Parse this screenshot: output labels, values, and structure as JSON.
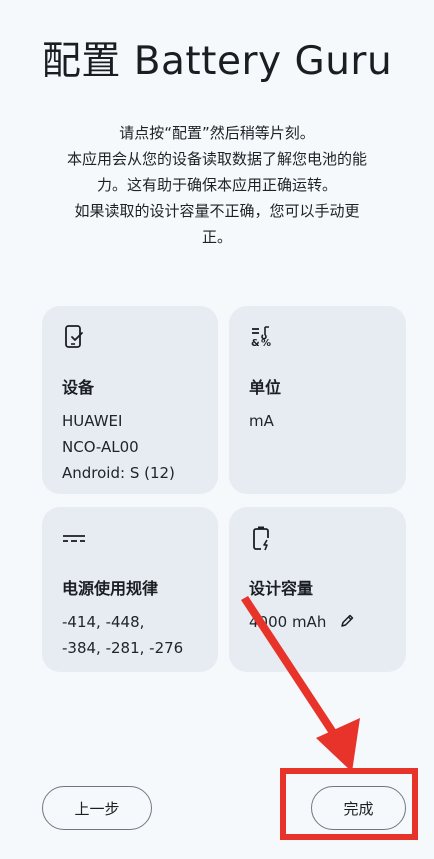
{
  "header": {
    "title": "配置 Battery Guru"
  },
  "intro": {
    "line1": "请点按“配置”然后稍等片刻。",
    "line2": "本应用会从您的设备读取数据了解您电池的能",
    "line3": "力。这有助于确保本应用正确运转。",
    "line4": "如果读取的设计容量不正确，您可以手动更",
    "line5": "正。"
  },
  "cards": {
    "device": {
      "icon": "phone-check-icon",
      "label": "设备",
      "line1": "HUAWEI",
      "line2": "NCO-AL00",
      "line3": "Android: S (12)"
    },
    "unit": {
      "icon": "units-icon",
      "label": "单位",
      "value": "mA"
    },
    "power": {
      "icon": "dc-current-icon",
      "label": "电源使用规律",
      "line1": "-414, -448,",
      "line2": "-384, -281, -276"
    },
    "capacity": {
      "icon": "battery-charging-icon",
      "label": "设计容量",
      "value": "4000 mAh",
      "edit_icon": "pencil-icon"
    }
  },
  "footer": {
    "back_label": "上一步",
    "done_label": "完成"
  },
  "colors": {
    "background": "#f6f9fb",
    "card": "#e6ecf1",
    "annotation": "#e8332a"
  }
}
